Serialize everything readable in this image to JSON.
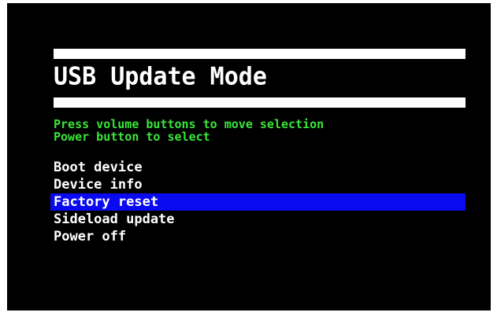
{
  "title": "USB Update Mode",
  "instructions": [
    "Press volume buttons to move selection",
    "Power button to select"
  ],
  "menu": {
    "items": [
      {
        "label": "Boot device"
      },
      {
        "label": "Device info"
      },
      {
        "label": "Factory reset"
      },
      {
        "label": "Sideload update"
      },
      {
        "label": "Power off"
      }
    ],
    "selected_index": 2
  },
  "colors": {
    "background": "#000000",
    "text": "#ffffff",
    "instructions": "#39e639",
    "highlight": "#0a0af0",
    "bars": "#ffffff"
  }
}
